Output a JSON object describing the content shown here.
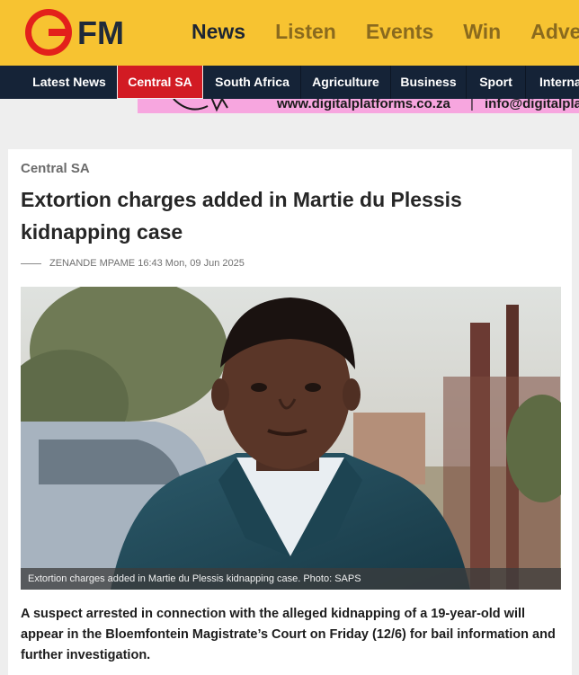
{
  "brand": {
    "logo_text": "OFM",
    "accent": "#f7c331",
    "nav_bg": "#152337",
    "active_red": "#d21b23"
  },
  "top_nav": [
    {
      "label": "News",
      "active": true
    },
    {
      "label": "Listen",
      "active": false
    },
    {
      "label": "Events",
      "active": false
    },
    {
      "label": "Win",
      "active": false
    },
    {
      "label": "Adve",
      "active": false
    }
  ],
  "section_nav": [
    {
      "label": "Latest News",
      "active": false
    },
    {
      "label": "Central SA",
      "active": true
    },
    {
      "label": "South Africa",
      "active": false
    },
    {
      "label": "Agriculture",
      "active": false
    },
    {
      "label": "Business",
      "active": false
    },
    {
      "label": "Sport",
      "active": false
    },
    {
      "label": "Internat",
      "active": false
    }
  ],
  "ad": {
    "url": "www.digitalplatforms.co.za",
    "separator": "|",
    "email": "info@digitalpla"
  },
  "article": {
    "category": "Central SA",
    "headline": "Extortion charges added in Martie du Plessis kidnapping case",
    "author": "ZENANDE MPAME",
    "timestamp": "16:43 Mon, 09 Jun 2025",
    "caption": "Extortion charges added in Martie du Plessis kidnapping case. Photo: SAPS",
    "lead": "A suspect arrested in connection with the alleged kidnapping of a 19-year-old will appear in the Bloemfontein Magistrate’s Court on Friday (12/6) for bail information and further investigation."
  }
}
